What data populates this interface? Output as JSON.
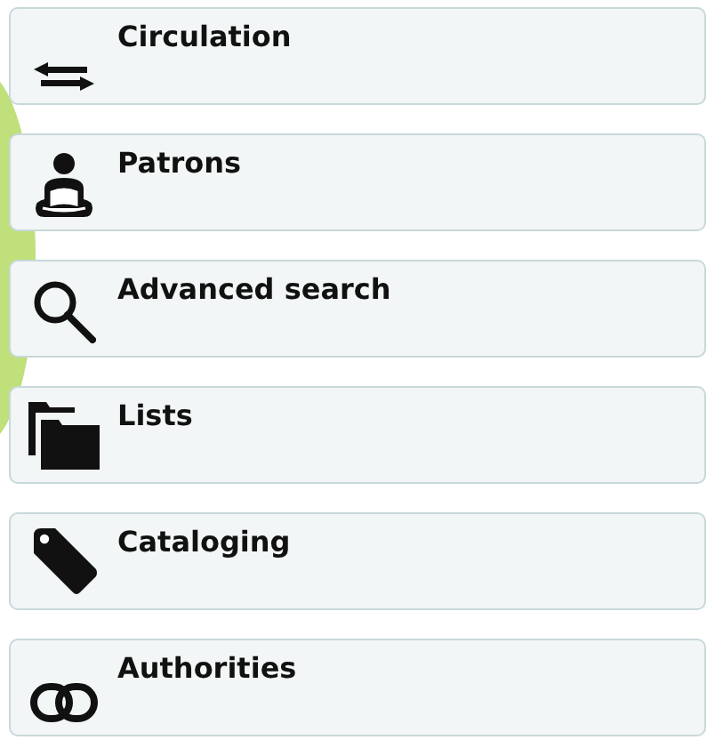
{
  "menu": [
    {
      "label": "Circulation",
      "kind": "arrows"
    },
    {
      "label": "Patrons",
      "kind": "patron"
    },
    {
      "label": "Advanced search",
      "kind": "search"
    },
    {
      "label": "Lists",
      "kind": "folders"
    },
    {
      "label": "Cataloging",
      "kind": "tag"
    },
    {
      "label": "Authorities",
      "kind": "link"
    }
  ]
}
